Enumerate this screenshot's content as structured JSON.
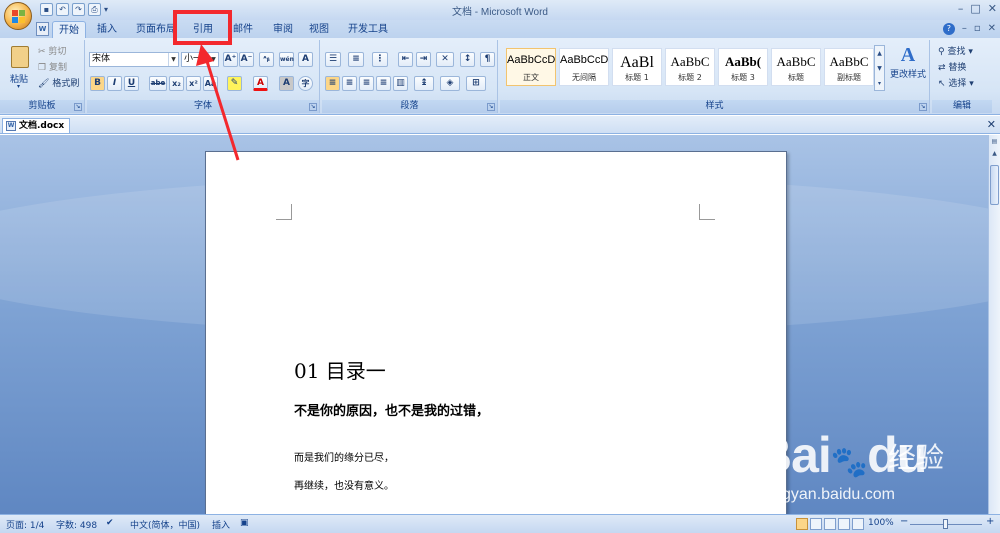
{
  "titlebar": {
    "title": "文档 - Microsoft Word",
    "qat": [
      "save",
      "undo",
      "redo",
      "print-preview"
    ],
    "controls": [
      "–",
      "□",
      "✕"
    ]
  },
  "tabs": [
    "开始",
    "插入",
    "页面布局",
    "引用",
    "邮件",
    "审阅",
    "视图",
    "开发工具"
  ],
  "active_tab": "开始",
  "highlighted_tab": "引用",
  "ribbon": {
    "clipboard": {
      "paste": "粘贴",
      "cut": "剪切",
      "copy": "复制",
      "format_painter": "格式刷",
      "label": "剪贴板"
    },
    "font": {
      "font_name": "宋体",
      "font_size": "小一",
      "label": "字体",
      "bold": "B",
      "italic": "I",
      "underline": "U",
      "strike": "abe",
      "sub": "x₂",
      "sup": "x²",
      "case": "Aa",
      "grow": "A⁺",
      "shrink": "A⁻",
      "clear": "ᴬᵦ",
      "phonetic": "wén",
      "border_char": "A",
      "shade_char": "A",
      "enclose": "字"
    },
    "paragraph": {
      "label": "段落"
    },
    "styles": {
      "label": "样式",
      "items": [
        {
          "sample": "AaBbCcD",
          "name": "正文",
          "selected": true
        },
        {
          "sample": "AaBbCcD",
          "name": "无间隔",
          "selected": false
        },
        {
          "sample": "AaBl",
          "name": "标题 1",
          "selected": false
        },
        {
          "sample": "AaBbC",
          "name": "标题 2",
          "selected": false
        },
        {
          "sample": "AaBb(",
          "name": "标题 3",
          "selected": false
        },
        {
          "sample": "AaBbC",
          "name": "标题",
          "selected": false
        },
        {
          "sample": "AaBbC",
          "name": "副标题",
          "selected": false
        }
      ],
      "change_styles": "更改样式"
    },
    "editing": {
      "find": "查找",
      "replace": "替换",
      "select": "选择",
      "label": "编辑"
    }
  },
  "document_tab": "文档.docx",
  "document": {
    "heading": "01 目录一",
    "bold_line": "不是你的原因，也不是我的过错，",
    "para1": "而是我们的缘分已尽，",
    "para2": "再继续，也没有意义。"
  },
  "statusbar": {
    "page": "页面: 1/4",
    "words": "字数: 498",
    "language": "中文(简体，中国)",
    "insert": "插入",
    "zoom": "100%",
    "zoom_minus": "−",
    "zoom_plus": "+"
  },
  "watermark": {
    "brand": "Bai",
    "brand2": "du",
    "brand_cn": "经验",
    "url": "jingyan.baidu.com"
  },
  "colors": {
    "annotation_red": "#f3282d",
    "ribbon_bg": "#d6e5f6",
    "workspace_bg": "#7fa3d4"
  }
}
